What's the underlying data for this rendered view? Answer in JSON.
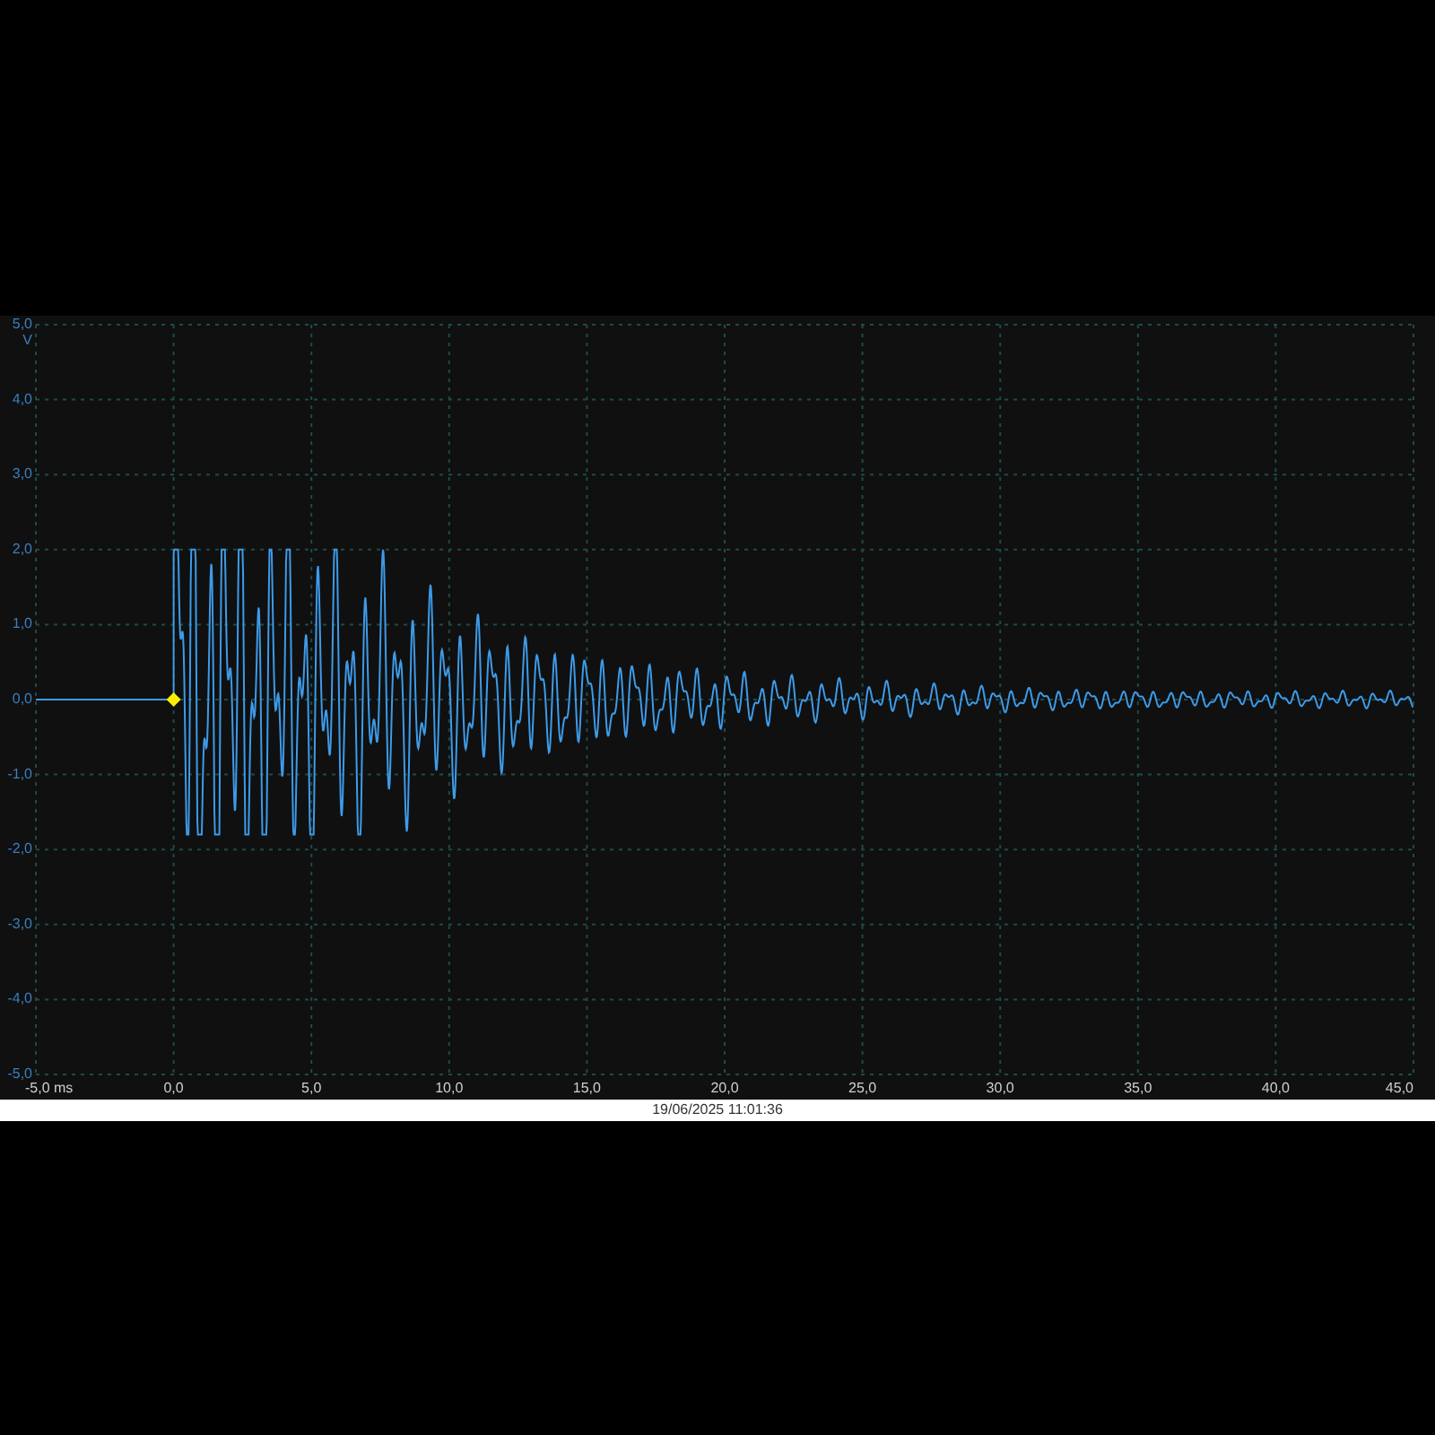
{
  "y_axis": {
    "unit": "V",
    "ticks": [
      "5,0",
      "4,0",
      "3,0",
      "2,0",
      "1,0",
      "0,0",
      "-1,0",
      "-2,0",
      "-3,0",
      "-4,0",
      "-5,0"
    ]
  },
  "x_axis": {
    "ticks": [
      "-5,0 ms",
      "0,0",
      "5,0",
      "10,0",
      "15,0",
      "20,0",
      "25,0",
      "30,0",
      "35,0",
      "40,0",
      "45,0"
    ]
  },
  "timestamp": "19/06/2025 11:01:36"
}
